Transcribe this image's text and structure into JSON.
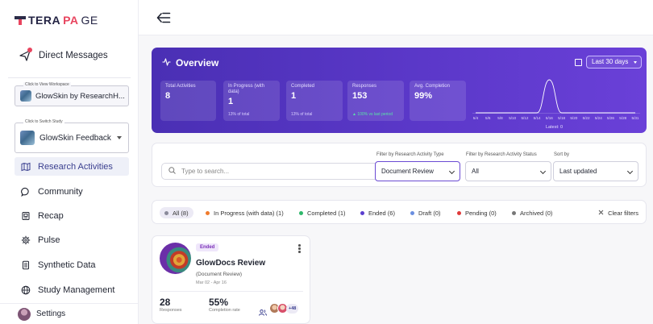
{
  "brand": {
    "logo_part1": "TERA",
    "logo_part2": "PA",
    "logo_part3": "GE"
  },
  "sidebar": {
    "direct_messages": "Direct Messages",
    "workspace_caption": "Click to View Workspace",
    "workspace_name": "GlowSkin by ResearchH...",
    "study_caption": "Click to Switch Study",
    "study_name": "GlowSkin Feedback",
    "items": [
      {
        "label": "Research Activities",
        "icon": "map-icon",
        "active": true
      },
      {
        "label": "Community",
        "icon": "chat-bubble-icon",
        "active": false
      },
      {
        "label": "Recap",
        "icon": "recap-icon",
        "active": false
      },
      {
        "label": "Pulse",
        "icon": "gear-pulse-icon",
        "active": false
      },
      {
        "label": "Synthetic Data",
        "icon": "document-icon",
        "active": false
      },
      {
        "label": "Study Management",
        "icon": "globe-icon",
        "active": false
      }
    ],
    "settings": "Settings"
  },
  "overview": {
    "title": "Overview",
    "range": "Last 30 days",
    "stats": [
      {
        "label": "Total Activities",
        "value": "8",
        "sub": ""
      },
      {
        "label": "In Progress (with data)",
        "value": "1",
        "sub": "13% of total"
      },
      {
        "label": "Completed",
        "value": "1",
        "sub": "13% of total"
      },
      {
        "label": "Responses",
        "value": "153",
        "sub": "▲ 100% vs last period"
      },
      {
        "label": "Avg. Completion",
        "value": "99%",
        "sub": ""
      }
    ],
    "latest": "Latest: 0"
  },
  "chart_data": {
    "type": "line",
    "x": [
      "5/4",
      "5/6",
      "5/8",
      "5/10",
      "5/12",
      "5/14",
      "5/16",
      "5/18",
      "5/20",
      "5/22",
      "5/24",
      "5/26",
      "5/28",
      "5/31"
    ],
    "series": [
      {
        "values": [
          0,
          0,
          0,
          0,
          0,
          0,
          150,
          0,
          0,
          0,
          0,
          0,
          0,
          0
        ]
      }
    ],
    "grid": false,
    "colors": {
      "line": "#ffffff"
    }
  },
  "filters": {
    "search_placeholder": "Type to search...",
    "type_label": "Filter by Research Activity Type",
    "type_value": "Document Review",
    "status_label": "Filter by Research Activity Status",
    "status_value": "All",
    "sort_label": "Sort by",
    "sort_value": "Last updated"
  },
  "chips": [
    {
      "label": "All (8)",
      "color": "#8a8a9a",
      "active": true
    },
    {
      "label": "In Progress (with data) (1)",
      "color": "#f07b2c",
      "active": false
    },
    {
      "label": "Completed (1)",
      "color": "#2fb86b",
      "active": false
    },
    {
      "label": "Ended (6)",
      "color": "#5b3fcf",
      "active": false
    },
    {
      "label": "Draft (0)",
      "color": "#6b8fe0",
      "active": false
    },
    {
      "label": "Pending (0)",
      "color": "#e03a3a",
      "active": false
    },
    {
      "label": "Archived (0)",
      "color": "#777777",
      "active": false
    }
  ],
  "clear_filters": "Clear filters",
  "card": {
    "status": "Ended",
    "title": "GlowDocs Review",
    "type": "(Document Review)",
    "dates": "Mar 02 - Apr 16",
    "responses_value": "28",
    "responses_label": "Responses",
    "completion_value": "55%",
    "completion_label": "Completion rate",
    "more_participants": "+48"
  }
}
